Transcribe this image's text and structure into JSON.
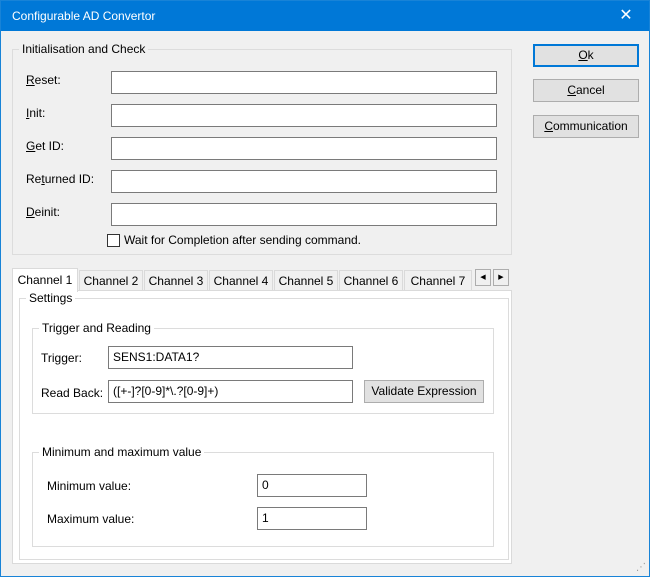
{
  "window": {
    "title": "Configurable AD Convertor",
    "close_glyph": "✕"
  },
  "init_group": {
    "title": "Initialisation and Check",
    "reset": {
      "label_hot": "R",
      "label_rest": "eset:",
      "value": ""
    },
    "init": {
      "label_hot": "I",
      "label_rest": "nit:",
      "value": ""
    },
    "get_id": {
      "label_hot": "G",
      "label_rest": "et ID:",
      "value": ""
    },
    "returned_id": {
      "label_pre": "Re",
      "label_hot": "t",
      "label_rest": "urned ID:",
      "value": ""
    },
    "deinit": {
      "label_hot": "D",
      "label_rest": "einit:",
      "value": ""
    },
    "wait_checkbox": {
      "label": "Wait for Completion after sending command.",
      "checked": false
    }
  },
  "buttons": {
    "ok": {
      "hot": "O",
      "rest": "k"
    },
    "cancel": {
      "hot": "C",
      "rest": "ancel"
    },
    "communication": {
      "hot": "C",
      "rest": "ommunication"
    }
  },
  "tabs": [
    "Channel 1",
    "Channel 2",
    "Channel 3",
    "Channel 4",
    "Channel 5",
    "Channel 6",
    "Channel 7"
  ],
  "selected_tab": "Channel 1",
  "tab_scroll": {
    "left_glyph": "◀",
    "right_glyph": "▶"
  },
  "settings": {
    "title": "Settings",
    "trigger_group": {
      "title": "Trigger and Reading",
      "trigger_label": "Trigger:",
      "trigger_value": "SENS1:DATA1?",
      "readback_label": "Read Back:",
      "readback_value": "([+-]?[0-9]*\\.?[0-9]+)",
      "validate_label": "Validate Expression"
    },
    "minmax_group": {
      "title": "Minimum and maximum value",
      "min_label": "Minimum value:",
      "min_value": "0",
      "max_label": "Maximum value:",
      "max_value": "1"
    }
  }
}
